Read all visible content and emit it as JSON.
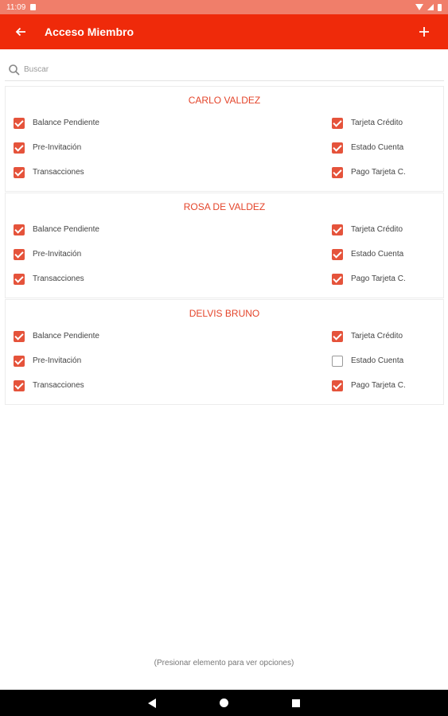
{
  "status": {
    "time": "11:09"
  },
  "appbar": {
    "title": "Acceso Miembro"
  },
  "search": {
    "placeholder": "Buscar"
  },
  "members": [
    {
      "name": "CARLO VALDEZ",
      "rows": [
        {
          "left": {
            "label": "Balance Pendiente",
            "checked": true
          },
          "right": {
            "label": "Tarjeta Crédito",
            "checked": true
          }
        },
        {
          "left": {
            "label": "Pre-Invitación",
            "checked": true
          },
          "right": {
            "label": "Estado Cuenta",
            "checked": true
          }
        },
        {
          "left": {
            "label": "Transacciones",
            "checked": true
          },
          "right": {
            "label": "Pago Tarjeta C.",
            "checked": true
          }
        }
      ]
    },
    {
      "name": "ROSA DE VALDEZ",
      "rows": [
        {
          "left": {
            "label": "Balance Pendiente",
            "checked": true
          },
          "right": {
            "label": "Tarjeta Crédito",
            "checked": true
          }
        },
        {
          "left": {
            "label": "Pre-Invitación",
            "checked": true
          },
          "right": {
            "label": "Estado Cuenta",
            "checked": true
          }
        },
        {
          "left": {
            "label": "Transacciones",
            "checked": true
          },
          "right": {
            "label": "Pago Tarjeta C.",
            "checked": true
          }
        }
      ]
    },
    {
      "name": "DELVIS BRUNO",
      "rows": [
        {
          "left": {
            "label": "Balance Pendiente",
            "checked": true
          },
          "right": {
            "label": "Tarjeta Crédito",
            "checked": true
          }
        },
        {
          "left": {
            "label": "Pre-Invitación",
            "checked": true
          },
          "right": {
            "label": "Estado Cuenta",
            "checked": false
          }
        },
        {
          "left": {
            "label": "Transacciones",
            "checked": true
          },
          "right": {
            "label": "Pago Tarjeta C.",
            "checked": true
          }
        }
      ]
    }
  ],
  "hint": "(Presionar elemento para ver opciones)",
  "colors": {
    "appbar": "#ef2a0a",
    "statusbar": "#f07e6a",
    "accent": "#e5533b",
    "member_name": "#e4442a"
  },
  "icons": {
    "back": "arrow-left-icon",
    "add": "plus-icon",
    "search": "search-icon"
  }
}
